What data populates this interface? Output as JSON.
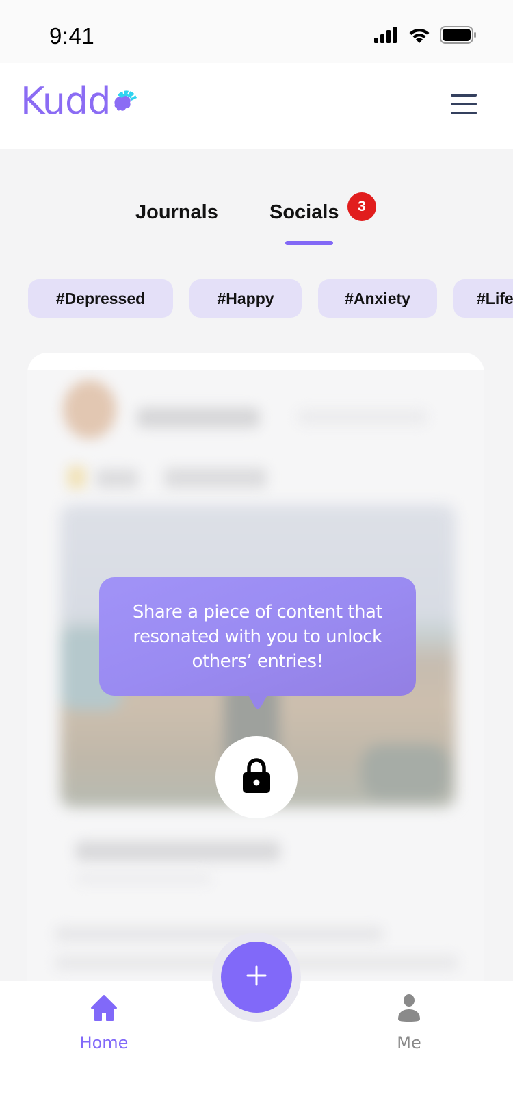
{
  "status_bar": {
    "time": "9:41",
    "icons": [
      "cellular-signal-icon",
      "wifi-icon",
      "battery-icon"
    ]
  },
  "header": {
    "logo_text": "Kudd",
    "logo_mark": "brain-logo-icon",
    "menu_icon": "hamburger-menu-icon"
  },
  "tabs": [
    {
      "label": "Journals",
      "active": false
    },
    {
      "label": "Socials",
      "active": true,
      "badge": "3"
    }
  ],
  "tags": [
    "#Depressed",
    "#Happy",
    "#Anxiety",
    "#Life"
  ],
  "locked_post": {
    "tooltip": "Share a piece of content that resonated with you to unlock others’ entries!",
    "lock_icon": "lock-icon",
    "blurred": true
  },
  "bottom_nav": {
    "items": [
      {
        "label": "Home",
        "icon": "home-icon",
        "active": true
      },
      {
        "label": "Me",
        "icon": "person-icon",
        "active": false
      }
    ],
    "fab_icon": "plus-icon"
  },
  "colors": {
    "accent": "#8169f9",
    "tag_bg": "#e4e0f8",
    "badge": "#e11d1d",
    "tooltip": "#9a8bf2",
    "menu_icon": "#34405e",
    "inactive_nav": "#8a8a8a",
    "logo_mark": "#2fd3f0"
  }
}
